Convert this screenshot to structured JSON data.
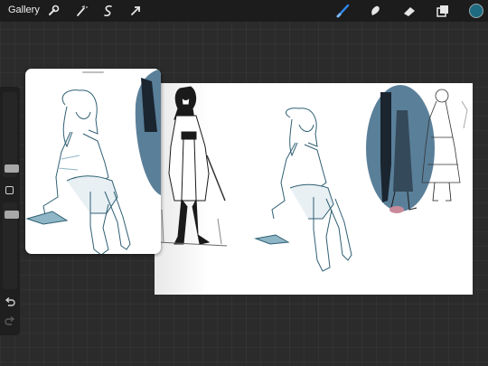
{
  "topbar": {
    "gallery_label": "Gallery",
    "left_tools": [
      {
        "name": "wrench-icon"
      },
      {
        "name": "magic-wand-icon"
      },
      {
        "name": "selection-icon"
      },
      {
        "name": "transform-arrow-icon"
      }
    ],
    "right_tools": [
      {
        "name": "brush-icon",
        "active": true
      },
      {
        "name": "smudge-icon"
      },
      {
        "name": "eraser-icon"
      },
      {
        "name": "layers-icon"
      }
    ],
    "current_color": "#1e6a80",
    "active_tool_color": "#2f8bf0"
  },
  "sidebar": {
    "brush_size_level": 0.45,
    "opacity_level": 0.9,
    "modify_button": "square-modify-icon",
    "undo": "undo-icon",
    "redo": "redo-icon"
  },
  "artwork": {
    "line_color": "#2f5f73",
    "shade_color": "#8fb6c6",
    "ink_color": "#1a1a1a"
  }
}
